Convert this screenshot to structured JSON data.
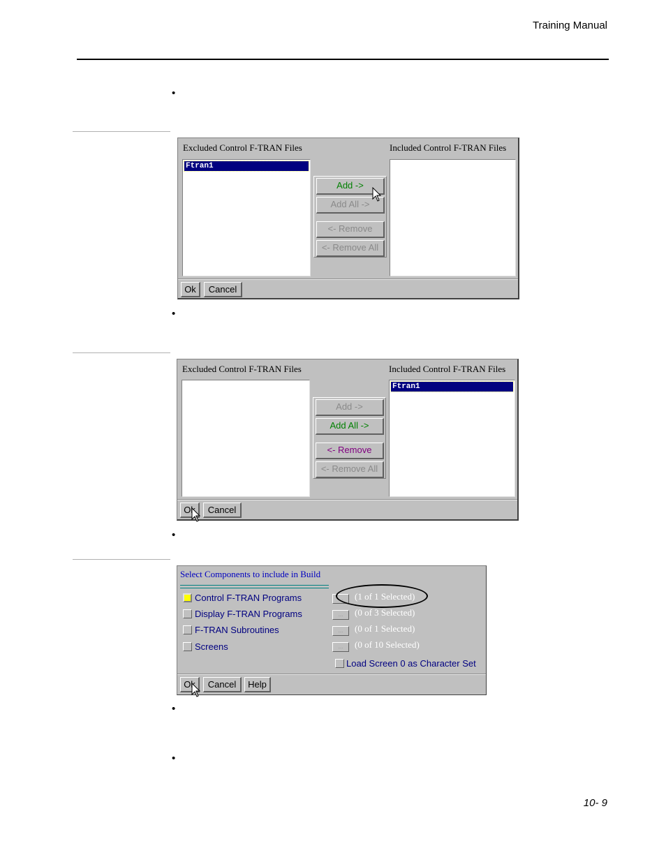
{
  "header": {
    "title": "Training Manual"
  },
  "footer": {
    "page_number": "10- 9"
  },
  "bullets": [
    "•",
    "•",
    "•",
    "•",
    "•"
  ],
  "dialog1": {
    "excluded_label": "Excluded Control F-TRAN Files",
    "included_label": "Included Control F-TRAN Files",
    "excluded_items": [
      "Ftran1"
    ],
    "included_items": [],
    "buttons": {
      "add": "Add ->",
      "add_all": "Add All ->",
      "remove": "<- Remove",
      "remove_all": "<- Remove All"
    },
    "ok": "Ok",
    "cancel": "Cancel"
  },
  "dialog2": {
    "excluded_label": "Excluded Control F-TRAN Files",
    "included_label": "Included Control F-TRAN Files",
    "excluded_items": [],
    "included_items": [
      "Ftran1"
    ],
    "buttons": {
      "add": "Add ->",
      "add_all": "Add All ->",
      "remove": "<- Remove",
      "remove_all": "<- Remove All"
    },
    "ok": "Ok",
    "cancel": "Cancel"
  },
  "dialog3": {
    "title": "Select Components to include in Build",
    "components": [
      {
        "label": "Control F-TRAN Programs",
        "checked": true,
        "count": "(1 of 1 Selected)"
      },
      {
        "label": "Display F-TRAN Programs",
        "checked": false,
        "count": "(0 of 3 Selected)"
      },
      {
        "label": "F-TRAN Subroutines",
        "checked": false,
        "count": "(0 of 1 Selected)"
      },
      {
        "label": "Screens",
        "checked": false,
        "count": "(0 of 10 Selected)"
      }
    ],
    "dots_label": "...",
    "load_screen_label": "Load Screen 0 as Character Set",
    "ok": "Ok",
    "cancel": "Cancel",
    "help": "Help"
  },
  "colors": {
    "dialog_bg": "#c0c0c0",
    "selection": "#000080",
    "enabled_green": "#008000",
    "enabled_purple": "#800080",
    "checked_yellow": "#ffff00",
    "label_blue": "#0000c0"
  }
}
